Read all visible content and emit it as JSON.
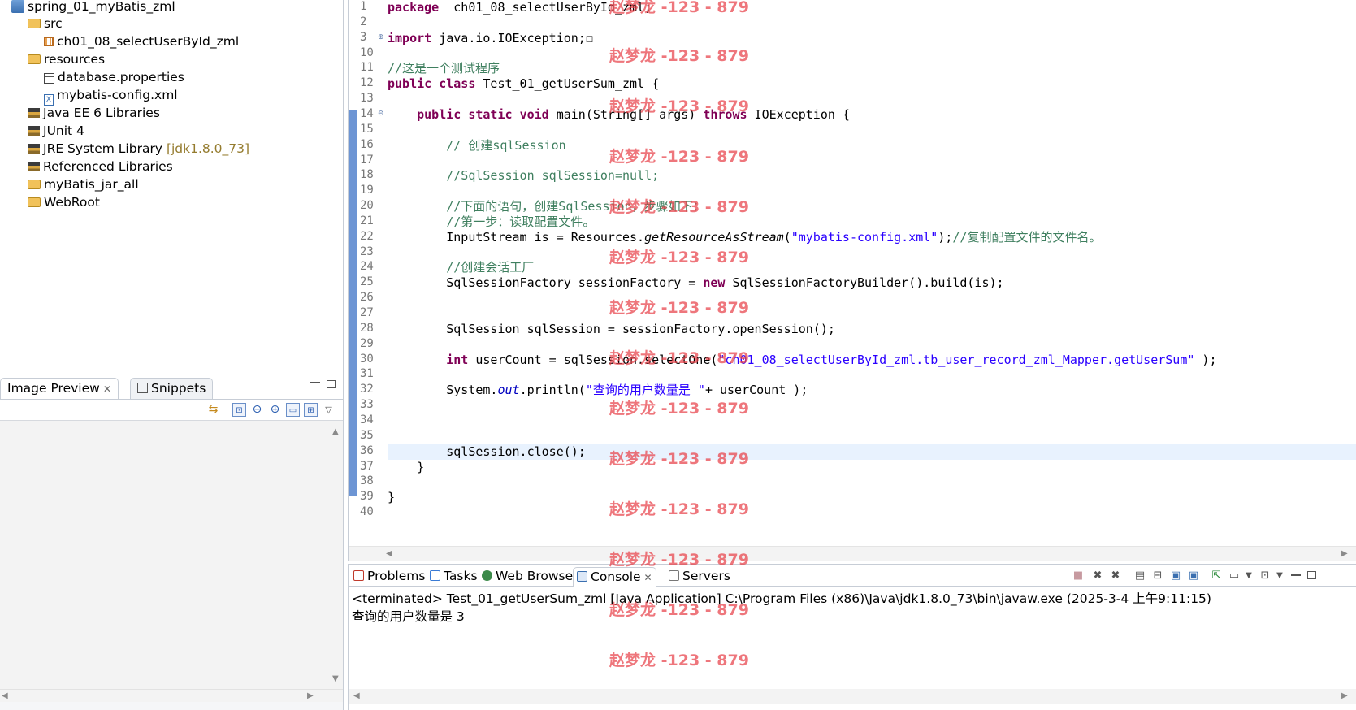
{
  "explorer": {
    "items": [
      {
        "label": "spring_01_myBatis_zml",
        "icon": "project-icon"
      },
      {
        "label": "src",
        "icon": "source-folder-icon"
      },
      {
        "label": "ch01_08_selectUserById_zml",
        "icon": "package-icon"
      },
      {
        "label": "resources",
        "icon": "source-folder-icon"
      },
      {
        "label": "database.properties",
        "icon": "properties-file-icon"
      },
      {
        "label": "mybatis-config.xml",
        "icon": "xml-file-icon"
      },
      {
        "label": "Java EE 6 Libraries",
        "icon": "library-icon"
      },
      {
        "label": "JUnit 4",
        "icon": "library-icon"
      },
      {
        "label": "JRE System Library",
        "suffix": "[jdk1.8.0_73]",
        "icon": "library-icon"
      },
      {
        "label": "Referenced Libraries",
        "icon": "library-icon"
      },
      {
        "label": "myBatis_jar_all",
        "icon": "folder-icon"
      },
      {
        "label": "WebRoot",
        "icon": "folder-icon"
      }
    ]
  },
  "preview": {
    "tabs": [
      {
        "label": "Image Preview"
      },
      {
        "label": "Snippets"
      }
    ]
  },
  "editor": {
    "line_numbers": [
      "1",
      "2",
      "3",
      "10",
      "11",
      "12",
      "13",
      "14",
      "15",
      "16",
      "17",
      "18",
      "19",
      "20",
      "21",
      "22",
      "23",
      "24",
      "25",
      "26",
      "27",
      "28",
      "29",
      "30",
      "31",
      "32",
      "33",
      "34",
      "35",
      "36",
      "37",
      "38",
      "39",
      "40"
    ],
    "lines": [
      {
        "t": [
          [
            "kw",
            "package"
          ],
          [
            "",
            "  ch01_08_selectUserById_zml;"
          ]
        ]
      },
      {
        "t": []
      },
      {
        "t": [
          [
            "kw",
            "import"
          ],
          [
            "",
            " java.io.IOException;"
          ],
          [
            "",
            "☐"
          ]
        ]
      },
      {
        "t": []
      },
      {
        "t": [
          [
            "cm",
            "//这是一个测试程序"
          ]
        ]
      },
      {
        "t": [
          [
            "kw",
            "public"
          ],
          [
            "",
            " "
          ],
          [
            "kw",
            "class"
          ],
          [
            "",
            " Test_01_getUserSum_zml {"
          ]
        ]
      },
      {
        "t": []
      },
      {
        "t": [
          [
            "",
            "    "
          ],
          [
            "kw",
            "public"
          ],
          [
            "",
            " "
          ],
          [
            "kw",
            "static"
          ],
          [
            "",
            " "
          ],
          [
            "kw",
            "void"
          ],
          [
            "",
            " main(String[] args) "
          ],
          [
            "kw",
            "throws"
          ],
          [
            "",
            " IOException {"
          ]
        ]
      },
      {
        "t": []
      },
      {
        "t": [
          [
            "",
            "        "
          ],
          [
            "cm",
            "// 创建sqlSession"
          ]
        ]
      },
      {
        "t": []
      },
      {
        "t": [
          [
            "",
            "        "
          ],
          [
            "cm",
            "//SqlSession sqlSession=null;"
          ]
        ]
      },
      {
        "t": []
      },
      {
        "t": [
          [
            "",
            "        "
          ],
          [
            "cm",
            "//下面的语句，创建SqlSession，步骤如下："
          ]
        ]
      },
      {
        "t": [
          [
            "",
            "        "
          ],
          [
            "cm",
            "//第一步：读取配置文件。"
          ]
        ]
      },
      {
        "t": [
          [
            "",
            "        InputStream is = Resources."
          ],
          [
            "it",
            "getResourceAsStream"
          ],
          [
            "",
            "("
          ],
          [
            "st",
            "\"mybatis-config.xml\""
          ],
          [
            "",
            ");"
          ],
          [
            "cm",
            "//复制配置文件的文件名。"
          ]
        ]
      },
      {
        "t": []
      },
      {
        "t": [
          [
            "",
            "        "
          ],
          [
            "cm",
            "//创建会话工厂"
          ]
        ]
      },
      {
        "t": [
          [
            "",
            "        SqlSessionFactory sessionFactory = "
          ],
          [
            "kw",
            "new"
          ],
          [
            "",
            " SqlSessionFactoryBuilder().build(is);"
          ]
        ]
      },
      {
        "t": []
      },
      {
        "t": []
      },
      {
        "t": [
          [
            "",
            "        SqlSession sqlSession = sessionFactory.openSession();"
          ]
        ]
      },
      {
        "t": []
      },
      {
        "t": [
          [
            "",
            "        "
          ],
          [
            "kw",
            "int"
          ],
          [
            "",
            " userCount = sqlSession.selectOne("
          ],
          [
            "st",
            "\"ch01_08_selectUserById_zml.tb_user_record_zml_Mapper.getUserSum\""
          ],
          [
            "",
            " );"
          ]
        ]
      },
      {
        "t": []
      },
      {
        "t": [
          [
            "",
            "        System."
          ],
          [
            "fld",
            "out"
          ],
          [
            "",
            ".println("
          ],
          [
            "st",
            "\"查询的用户数量是 \""
          ],
          [
            "",
            "+ userCount );"
          ]
        ]
      },
      {
        "t": []
      },
      {
        "t": []
      },
      {
        "t": []
      },
      {
        "t": [
          [
            "",
            "        sqlSession.close();"
          ]
        ]
      },
      {
        "t": [
          [
            "",
            "    }"
          ]
        ]
      },
      {
        "t": []
      },
      {
        "t": [
          [
            "",
            "}"
          ]
        ]
      },
      {
        "t": []
      }
    ]
  },
  "console": {
    "tabs": [
      {
        "label": "Problems",
        "color": "#c0392b"
      },
      {
        "label": "Tasks",
        "color": "#3a7bd5"
      },
      {
        "label": "Web Browser",
        "color": "#2a7f3f"
      },
      {
        "label": "Console",
        "color": "#3a6fb0"
      },
      {
        "label": "Servers",
        "color": "#777777"
      }
    ],
    "status": "<terminated> Test_01_getUserSum_zml [Java Application] C:\\Program Files (x86)\\Java\\jdk1.8.0_73\\bin\\javaw.exe (2025-3-4 上午9:11:15)",
    "output": "查询的用户数量是 3"
  },
  "watermark": {
    "text": "赵梦龙 -123 - 879"
  },
  "colors": {
    "keyword": "#7f0055",
    "comment": "#3f7f5f",
    "string": "#2a00ff",
    "current_line": "#e8f2fe",
    "watermark": "#e8424a"
  }
}
